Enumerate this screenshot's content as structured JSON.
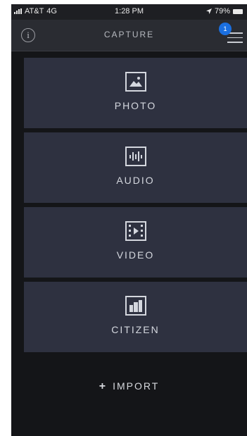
{
  "status_bar": {
    "carrier": "AT&T",
    "network": "4G",
    "time": "1:28 PM",
    "battery": "79%"
  },
  "nav": {
    "title": "CAPTURE",
    "info_glyph": "i",
    "badge_count": "1"
  },
  "tiles": [
    {
      "label": "PHOTO",
      "icon": "photo-icon"
    },
    {
      "label": "AUDIO",
      "icon": "audio-waveform-icon"
    },
    {
      "label": "VIDEO",
      "icon": "video-film-icon"
    },
    {
      "label": "CITIZEN",
      "icon": "citizen-icon"
    }
  ],
  "import": {
    "plus": "+",
    "label": "IMPORT"
  },
  "colors": {
    "background": "#141518",
    "tile": "#2e3140",
    "badge": "#1a6fe0"
  }
}
